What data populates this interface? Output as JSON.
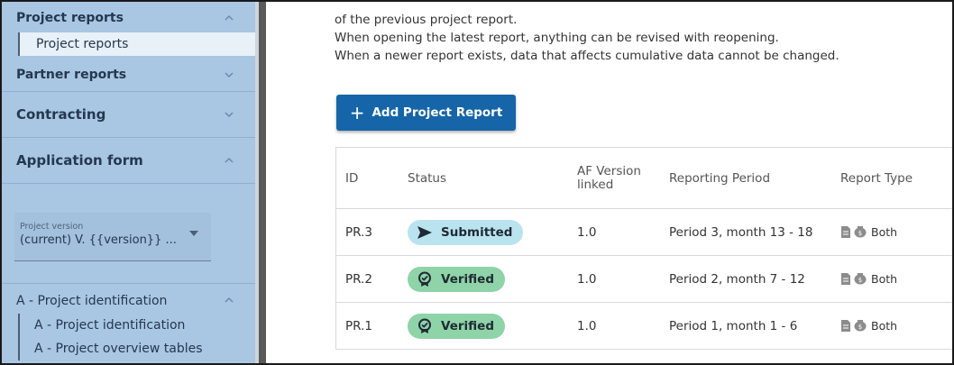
{
  "sidebar": {
    "sections": [
      {
        "label": "Project reports",
        "expanded": true,
        "items": [
          "Project reports"
        ]
      },
      {
        "label": "Partner reports",
        "expanded": false
      },
      {
        "label": "Contracting",
        "expanded": false
      },
      {
        "label": "Application form",
        "expanded": true
      }
    ],
    "project_version": {
      "label": "Project version",
      "value": "(current) V. {{version}} ..."
    },
    "identification": {
      "label": "A - Project identification",
      "expanded": true,
      "items": [
        "A - Project identification",
        "A - Project overview tables"
      ]
    }
  },
  "main": {
    "intro_lines": [
      "of the previous project report.",
      "When opening the latest report, anything can be revised with reopening.",
      "When a newer report exists, data that affects cumulative data cannot be changed."
    ],
    "add_button": {
      "icon": "plus-icon",
      "label": "Add Project Report"
    },
    "table": {
      "headers": {
        "id": "ID",
        "status": "Status",
        "af_version": "AF Version linked",
        "period": "Reporting Period",
        "type": "Report Type"
      },
      "rows": [
        {
          "id": "PR.3",
          "status": "Submitted",
          "status_icon": "send-icon",
          "af_version": "1.0",
          "period": "Period 3, month 13 - 18",
          "type": "Both"
        },
        {
          "id": "PR.2",
          "status": "Verified",
          "status_icon": "verified-badge-icon",
          "af_version": "1.0",
          "period": "Period 2, month 7 - 12",
          "type": "Both"
        },
        {
          "id": "PR.1",
          "status": "Verified",
          "status_icon": "verified-badge-icon",
          "af_version": "1.0",
          "period": "Period 1, month 1 - 6",
          "type": "Both"
        }
      ]
    }
  },
  "colors": {
    "sidebar_bg": "#a9c6e3",
    "primary_button": "#1565a8",
    "submitted_badge": "#b9e4ef",
    "verified_badge": "#8fd3a8"
  }
}
